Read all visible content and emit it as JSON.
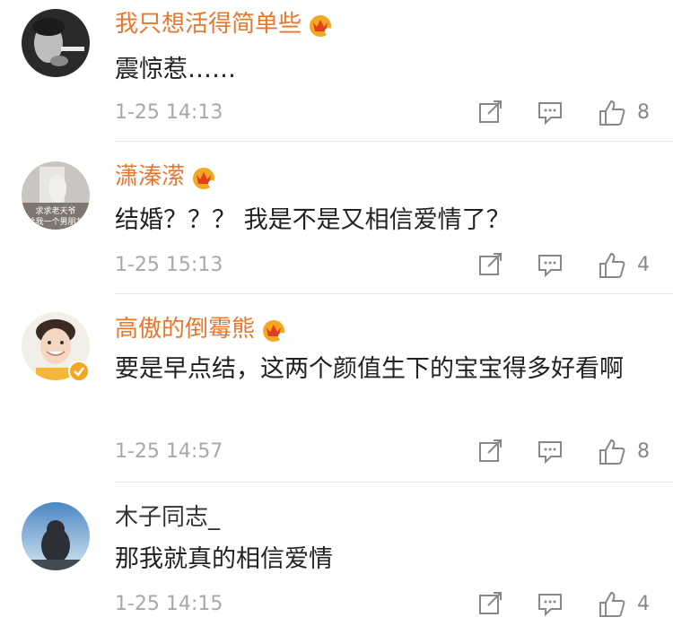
{
  "comments": [
    {
      "name": "我只想活得简单些",
      "text": "震惊惹……",
      "time": "1-25 14:13",
      "likes": "8"
    },
    {
      "name": "潇溱潆",
      "text": "结婚？？？ 我是不是又相信爱情了？",
      "time": "1-25 15:13",
      "likes": "4",
      "avatar_text": "求求老天爷 再给我一个男朋友吧"
    },
    {
      "name": "高傲的倒霉熊",
      "text": "要是早点结，这两个颜值生下的宝宝得多好看啊",
      "time": "1-25 14:57",
      "likes": "8"
    },
    {
      "name": "木子同志_",
      "text": "那我就真的相信爱情",
      "time": "1-25 14:15",
      "likes": "4"
    }
  ],
  "colors": {
    "username": "#e8772e",
    "crown": "#f5a623",
    "meta": "#a8a8a8",
    "icon": "#888888"
  },
  "icons": [
    "repost-icon",
    "comment-icon",
    "like-icon",
    "crown-icon",
    "verified-icon"
  ]
}
